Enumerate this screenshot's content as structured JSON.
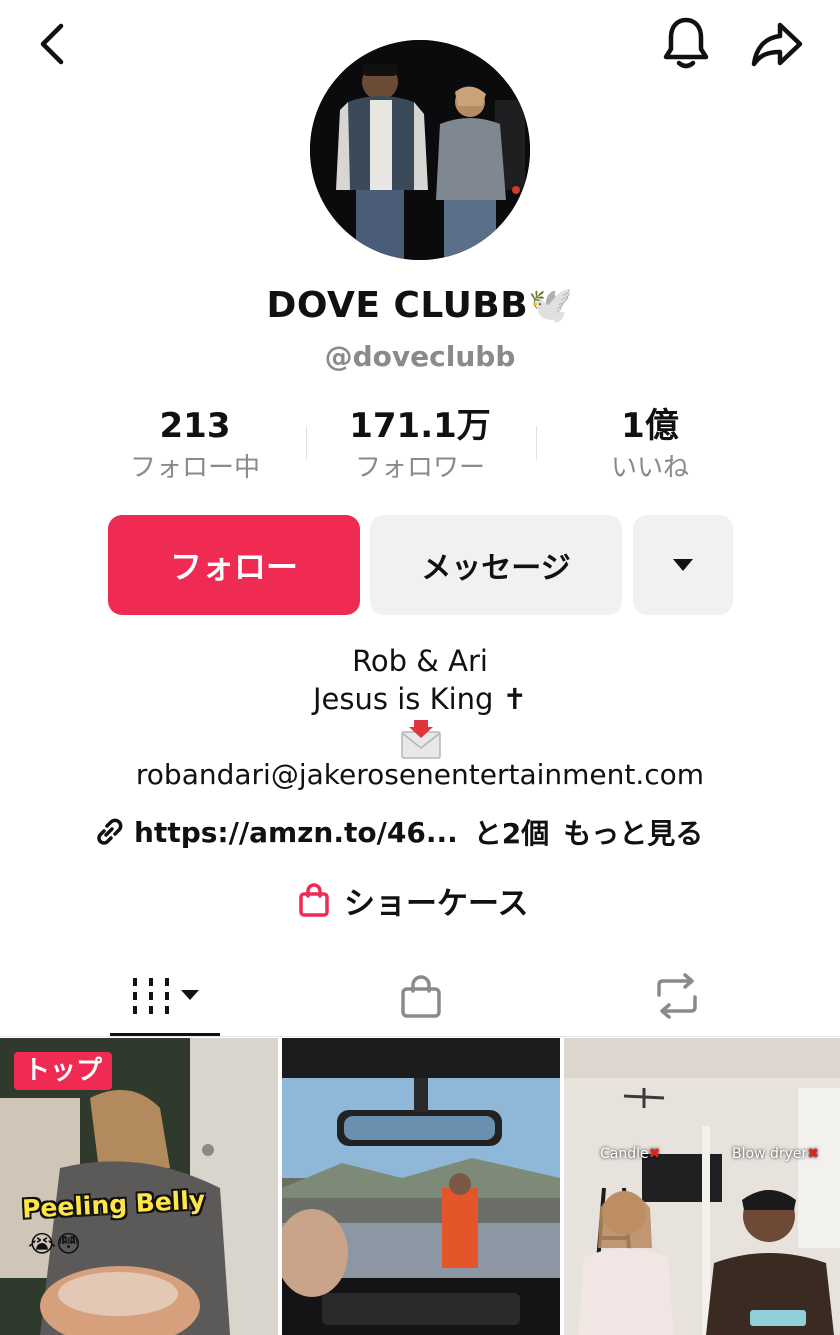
{
  "header": {
    "back_icon": "chevron-left-icon",
    "bell_icon": "bell-icon",
    "share_icon": "share-arrow-icon"
  },
  "profile": {
    "display_name": "DOVE CLUBB🕊️",
    "handle": "@doveclubb"
  },
  "stats": [
    {
      "value": "213",
      "label": "フォロー中"
    },
    {
      "value": "171.1万",
      "label": "フォロワー"
    },
    {
      "value": "1億",
      "label": "いいね"
    }
  ],
  "actions": {
    "follow_label": "フォロー",
    "message_label": "メッセージ",
    "more_icon": "caret-down-icon"
  },
  "bio": {
    "line1": "Rob & Ari",
    "line2": "Jesus is King ✝",
    "icon": "📩",
    "email": "robandari@jakerosenentertainment.com"
  },
  "links": {
    "url": "https://amzn.to/46...",
    "extra": "と2個",
    "more": "もっと見る"
  },
  "showcase": {
    "label": "ショーケース"
  },
  "tabs": [
    {
      "name": "videos",
      "icon": "grid-icon",
      "active": true
    },
    {
      "name": "shop",
      "icon": "shopping-bag-icon",
      "active": false
    },
    {
      "name": "reposts",
      "icon": "repost-icon",
      "active": false
    }
  ],
  "videos": [
    {
      "badge": "トップ",
      "caption": "Peeling Belly",
      "emoji": "😭😳"
    },
    {
      "caption": ""
    },
    {
      "label_left": "Candle",
      "label_right": "Blow dryer",
      "x_mark": "✖"
    }
  ],
  "colors": {
    "accent": "#ef2a53",
    "secondary_button": "#f1f1f2",
    "muted_text": "#8a8a8a"
  }
}
